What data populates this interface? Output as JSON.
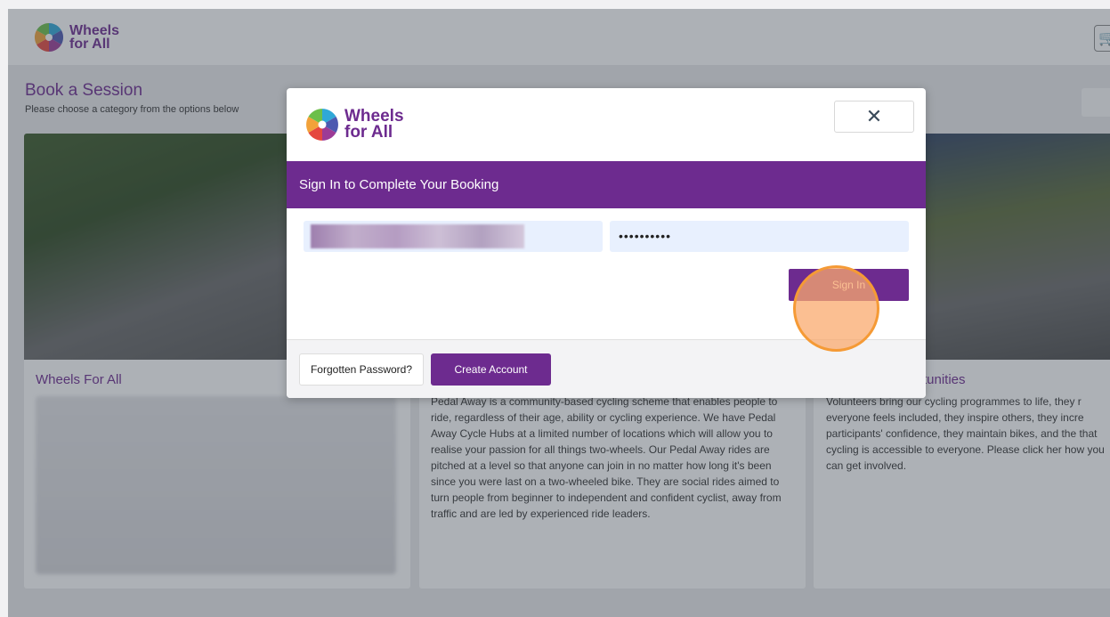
{
  "brand": {
    "line1": "Wheels",
    "line2": "for All",
    "color": "#6d2b8f"
  },
  "page": {
    "title": "Book a Session",
    "subtitle": "Please choose a category from the options below",
    "cards": [
      {
        "heading": "Wheels For All",
        "text": ""
      },
      {
        "heading": "",
        "text": "Pedal Away is a community-based cycling scheme that enables people to ride, regardless of their age, ability or cycling experience. We have Pedal Away Cycle Hubs at a limited number of locations which will allow you to realise your passion for all things two-wheels. Our Pedal Away rides are pitched at a level so that anyone can join in no matter how long it's been since you were last on a two-wheeled bike. They are social rides aimed to turn people from beginner to independent and confident cyclist, away from traffic and are led by experienced ride leaders."
      },
      {
        "heading": "rtunities",
        "text": "Volunteers bring our cycling programmes to life, they r everyone feels included, they inspire others, they incre participants' confidence, they maintain bikes, and the that cycling is accessible to everyone. Please click her how you can get involved."
      }
    ]
  },
  "modal": {
    "close_icon": "✕",
    "header": "Sign In to Complete Your Booking",
    "email_value": "",
    "password_value": "••••••••••",
    "signin_label": "Sign In",
    "forgot_label": "Forgotten Password?",
    "create_label": "Create Account"
  }
}
